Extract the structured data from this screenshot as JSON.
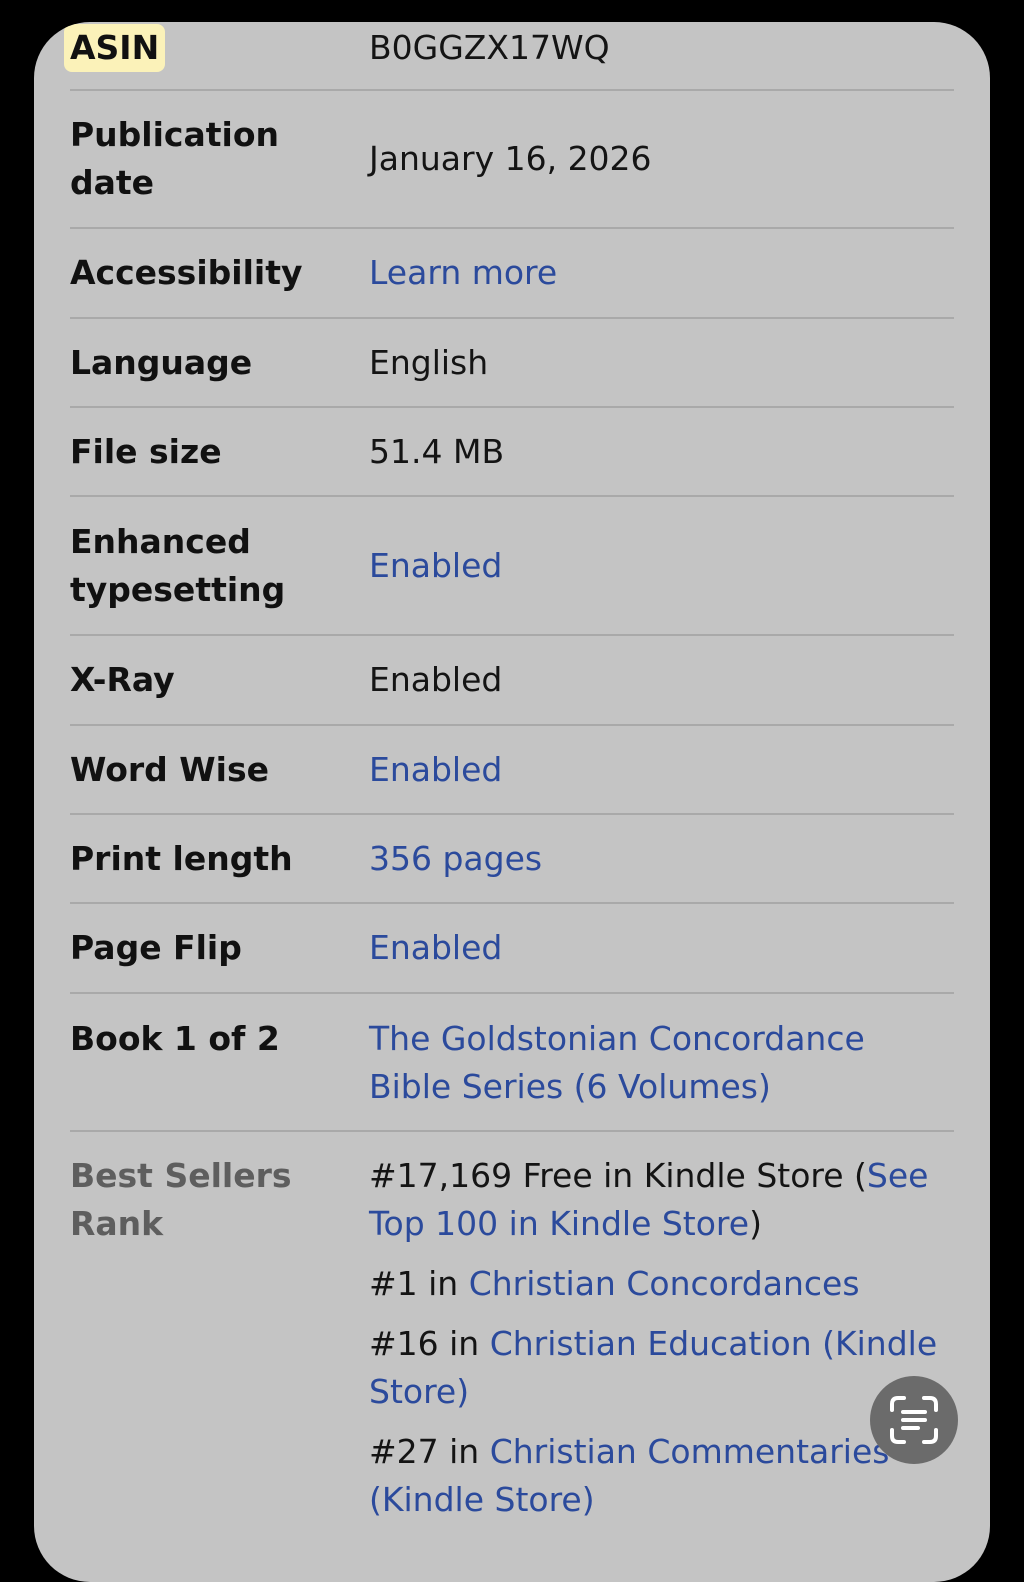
{
  "details": {
    "asin": {
      "label": "ASIN",
      "value": "B0GGZX17WQ"
    },
    "publication_date": {
      "label": "Publication date",
      "value": "January 16, 2026"
    },
    "accessibility": {
      "label": "Accessibility",
      "value": "Learn more"
    },
    "language": {
      "label": "Language",
      "value": "English"
    },
    "file_size": {
      "label": "File size",
      "value": "51.4 MB"
    },
    "enhanced_typesetting": {
      "label": "Enhanced typesetting",
      "value": "Enabled"
    },
    "xray": {
      "label": "X-Ray",
      "value": "Enabled"
    },
    "word_wise": {
      "label": "Word Wise",
      "value": "Enabled"
    },
    "print_length": {
      "label": "Print length",
      "value": "356 pages"
    },
    "page_flip": {
      "label": "Page Flip",
      "value": "Enabled"
    },
    "series": {
      "label": "Book 1 of 2",
      "value": "The Goldstonian Concordance Bible Series (6 Volumes)"
    }
  },
  "best_sellers": {
    "label": "Best Sellers Rank",
    "ranks": [
      {
        "prefix": "#17,169 Free in Kindle Store (",
        "link": "See Top 100 in Kindle Store",
        "suffix": ")"
      },
      {
        "prefix": "#1 in ",
        "link": "Christian Concordances",
        "suffix": ""
      },
      {
        "prefix": "#16 in ",
        "link": "Christian Education (Kindle Store)",
        "suffix": ""
      },
      {
        "prefix": "#27 in ",
        "link": "Christian Commentaries (Kindle Store)",
        "suffix": ""
      }
    ]
  },
  "colors": {
    "card_background": "#c4c4c4",
    "link": "#2b4a9c",
    "highlight": "#fbf2b9"
  },
  "icons": {
    "scan_button": "text-scan-icon"
  }
}
